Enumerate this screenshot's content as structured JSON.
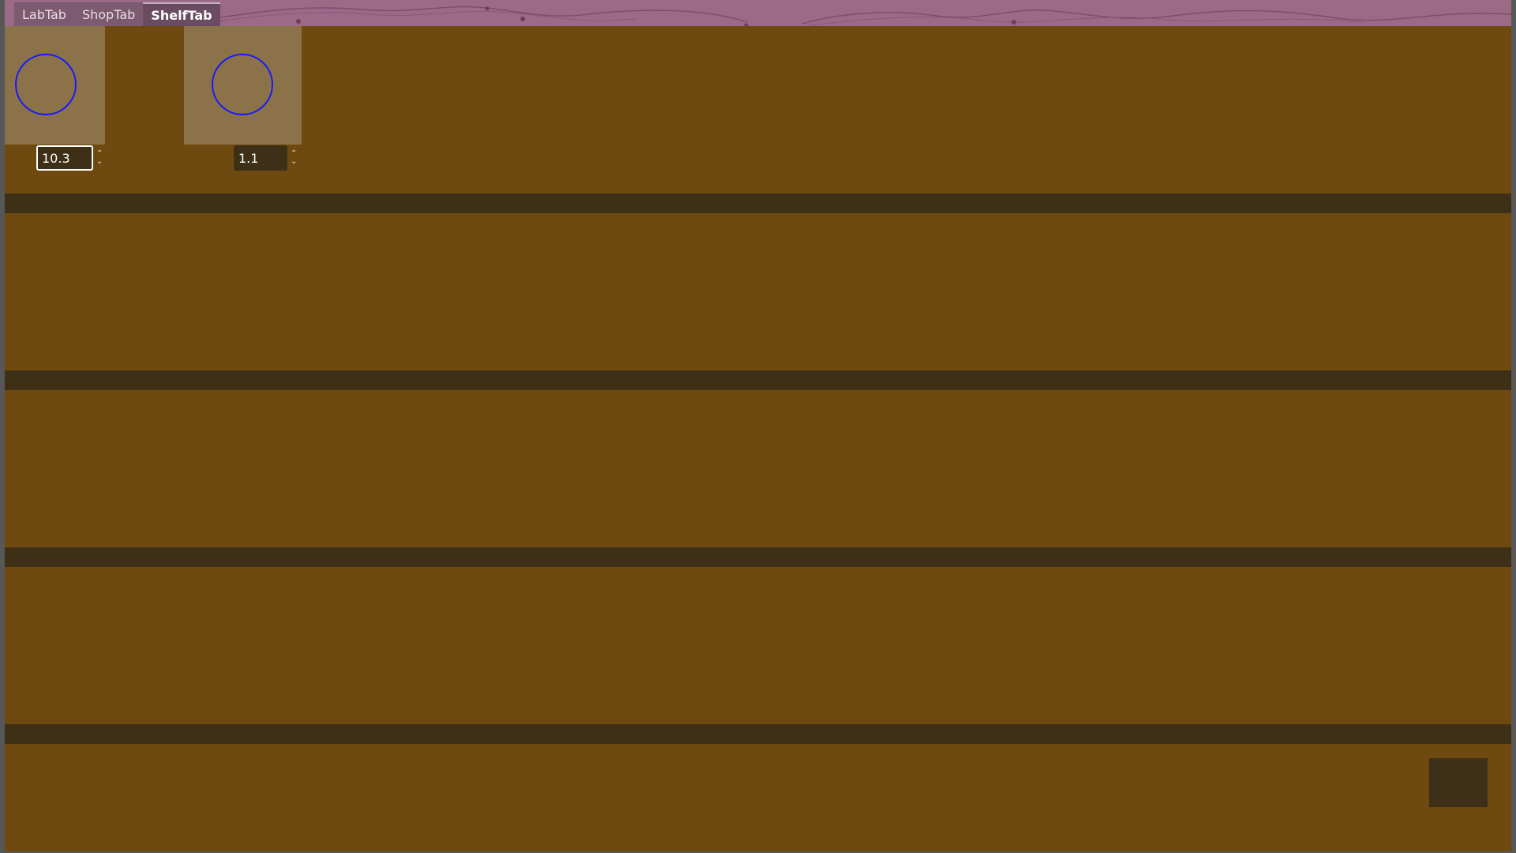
{
  "tabs": [
    {
      "label": "LabTab",
      "active": false
    },
    {
      "label": "ShopTab",
      "active": false
    },
    {
      "label": "ShelfTab",
      "active": true
    }
  ],
  "shelf": {
    "slots": [
      {
        "value": "10.3",
        "focused": true
      },
      {
        "value": "1.1",
        "focused": false
      }
    ]
  },
  "colors": {
    "header": "#9b6a87",
    "shelf_background": "#6e4a10",
    "shelf_divider": "#3e2f17",
    "slot_background": "#8b7248",
    "circle_stroke": "#1a18ff"
  },
  "icons": {
    "spin_up": "chevron-up-icon",
    "spin_down": "chevron-down-icon"
  }
}
